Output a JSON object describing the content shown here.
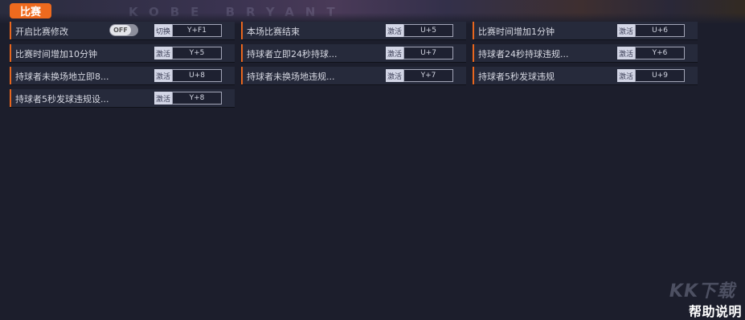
{
  "banner": {
    "watermark": "KOBE BRYANT"
  },
  "section": {
    "label": "比赛"
  },
  "rows": {
    "r1": {
      "label": "开启比赛修改",
      "toggle": "OFF",
      "action": "切换",
      "key": "Y+F1"
    },
    "r2": {
      "label": "本场比赛结束",
      "action": "激活",
      "key": "U+5"
    },
    "r3": {
      "label": "比赛时间增加1分钟",
      "action": "激活",
      "key": "U+6"
    },
    "r4": {
      "label": "比赛时间增加10分钟",
      "action": "激活",
      "key": "Y+5"
    },
    "r5": {
      "label": "持球者立即24秒持球...",
      "action": "激活",
      "key": "U+7"
    },
    "r6": {
      "label": "持球者24秒持球违规...",
      "action": "激活",
      "key": "Y+6"
    },
    "r7": {
      "label": "持球者未换场地立即8...",
      "action": "激活",
      "key": "U+8"
    },
    "r8": {
      "label": "持球者未换场地违规...",
      "action": "激活",
      "key": "Y+7"
    },
    "r9": {
      "label": "持球者5秒发球违规",
      "action": "激活",
      "key": "U+9"
    },
    "r10": {
      "label": "持球者5秒发球违规设...",
      "action": "激活",
      "key": "Y+8"
    }
  },
  "footer": {
    "watermark": "KK下载",
    "help": "帮助说明"
  }
}
